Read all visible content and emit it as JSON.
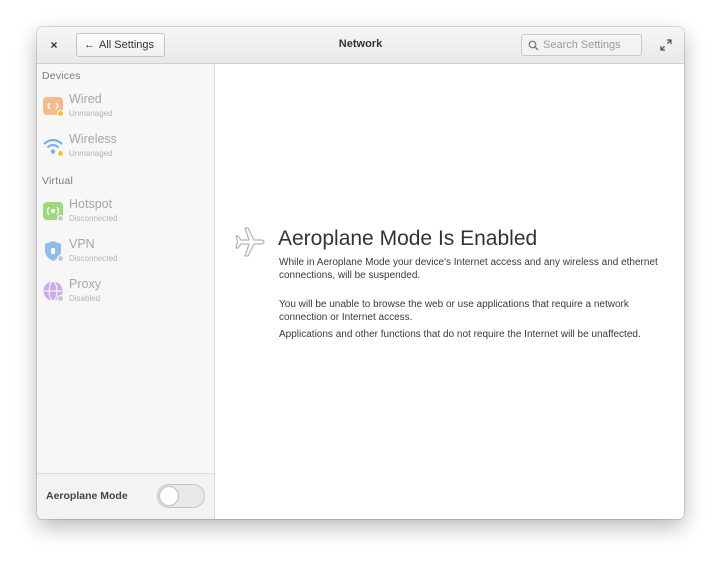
{
  "window": {
    "title": "Network",
    "back_label": "All Settings",
    "close_glyph": "×",
    "search_placeholder": "Search Settings"
  },
  "sidebar": {
    "sections": [
      {
        "header": "Devices",
        "items": [
          {
            "label": "Wired",
            "status": "Unmanaged",
            "icon": "wired-icon",
            "color": "#f0a05a",
            "dot": "#f2c230"
          },
          {
            "label": "Wireless",
            "status": "Unmanaged",
            "icon": "wireless-icon",
            "color": "#4a90d9",
            "dot": "#f2c230"
          }
        ]
      },
      {
        "header": "Virtual",
        "items": [
          {
            "label": "Hotspot",
            "status": "Disconnected",
            "icon": "hotspot-icon",
            "color": "#68b723",
            "dot": "#c0c0c0"
          },
          {
            "label": "VPN",
            "status": "Disconnected",
            "icon": "vpn-shield-icon",
            "color": "#3689e6",
            "dot": "#c0c0c0"
          },
          {
            "label": "Proxy",
            "status": "Disabled",
            "icon": "proxy-icon",
            "color": "#a56de2",
            "dot": "#c0c0c0"
          }
        ]
      }
    ],
    "footer": {
      "label": "Aeroplane Mode",
      "toggle_on": false
    }
  },
  "main": {
    "heading": "Aeroplane Mode Is Enabled",
    "paragraphs": [
      "While in Aeroplane Mode your device's Internet access and any wireless and ethernet connections, will be suspended.",
      "You will be unable to browse the web or use applications that require a network connection or Internet access.",
      "Applications and other functions that do not require the Internet will be unaffected."
    ]
  }
}
